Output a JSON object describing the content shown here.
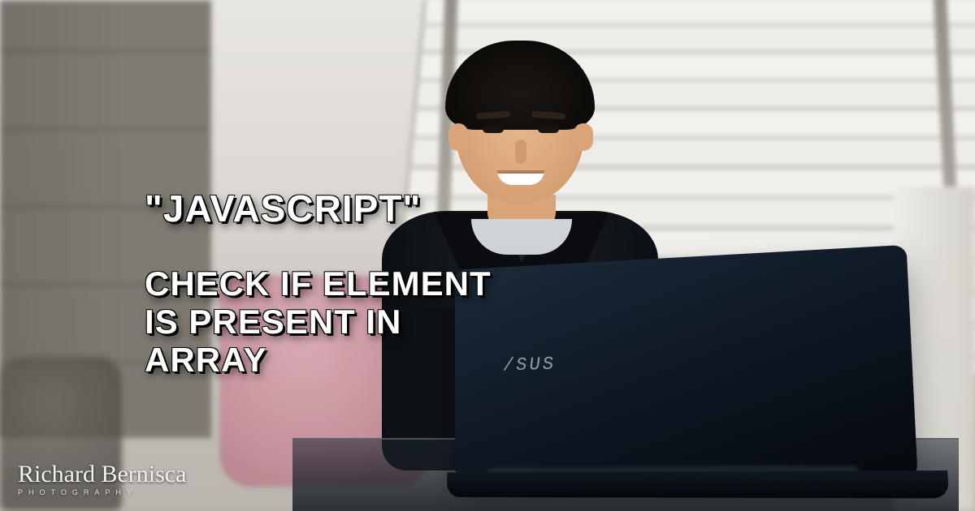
{
  "overlay": {
    "line1": "\"JAVASCRIPT\"",
    "line2": "CHECK IF ELEMENT",
    "line3": "IS PRESENT IN",
    "line4": "ARRAY"
  },
  "laptop": {
    "brand": "/SUS"
  },
  "watermark": {
    "signature": "Richard Bernisca",
    "subtitle": "PHOTOGRAPHY"
  }
}
